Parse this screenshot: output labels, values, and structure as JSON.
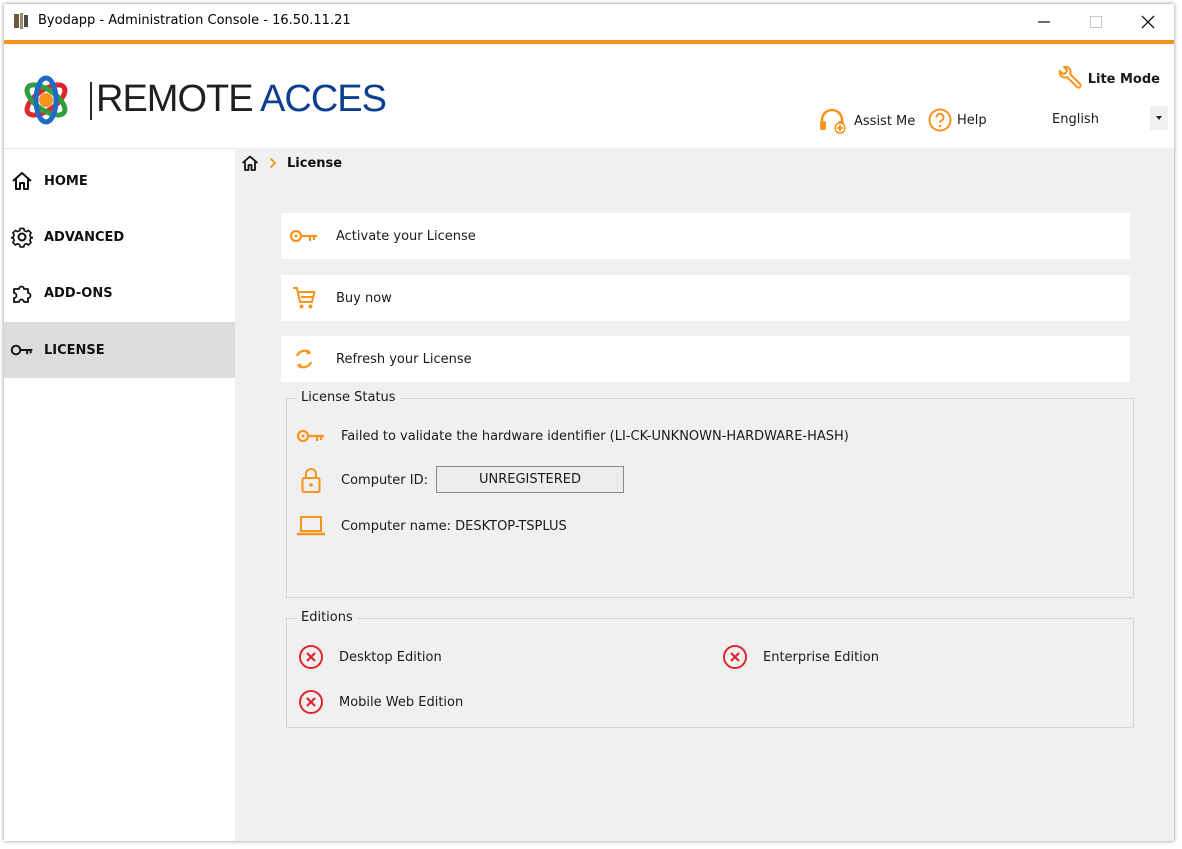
{
  "window": {
    "title": "Byodapp - Administration Console - 16.50.11.21"
  },
  "header": {
    "brand_word1": "REMOTE",
    "brand_word2": "ACCES",
    "lite_mode": "Lite Mode",
    "assist_me": "Assist Me",
    "help": "Help",
    "language": "English"
  },
  "sidebar": {
    "items": [
      {
        "label": "HOME",
        "icon": "home-icon"
      },
      {
        "label": "ADVANCED",
        "icon": "gear-icon"
      },
      {
        "label": "ADD-ONS",
        "icon": "puzzle-icon"
      },
      {
        "label": "LICENSE",
        "icon": "key-icon",
        "active": true
      }
    ]
  },
  "breadcrumb": {
    "current": "License"
  },
  "actions": [
    {
      "label": "Activate your License",
      "icon": "key-icon"
    },
    {
      "label": "Buy now",
      "icon": "cart-icon"
    },
    {
      "label": "Refresh your License",
      "icon": "refresh-icon"
    }
  ],
  "license_status": {
    "title": "License Status",
    "hardware_message": "Failed to validate the hardware identifier (LI-CK-UNKNOWN-HARDWARE-HASH)",
    "computer_id_label": "Computer ID:",
    "computer_id_value": "UNREGISTERED",
    "computer_name": "Computer name: DESKTOP-TSPLUS"
  },
  "editions": {
    "title": "Editions",
    "items": [
      {
        "label": "Desktop Edition",
        "status": "unavailable"
      },
      {
        "label": "Enterprise Edition",
        "status": "unavailable"
      },
      {
        "label": "Mobile Web Edition",
        "status": "unavailable"
      }
    ]
  },
  "colors": {
    "accent": "#f7941d",
    "brand_blue": "#0d3f91",
    "error_red": "#e0262d",
    "active_nav": "#dcdcdc"
  }
}
